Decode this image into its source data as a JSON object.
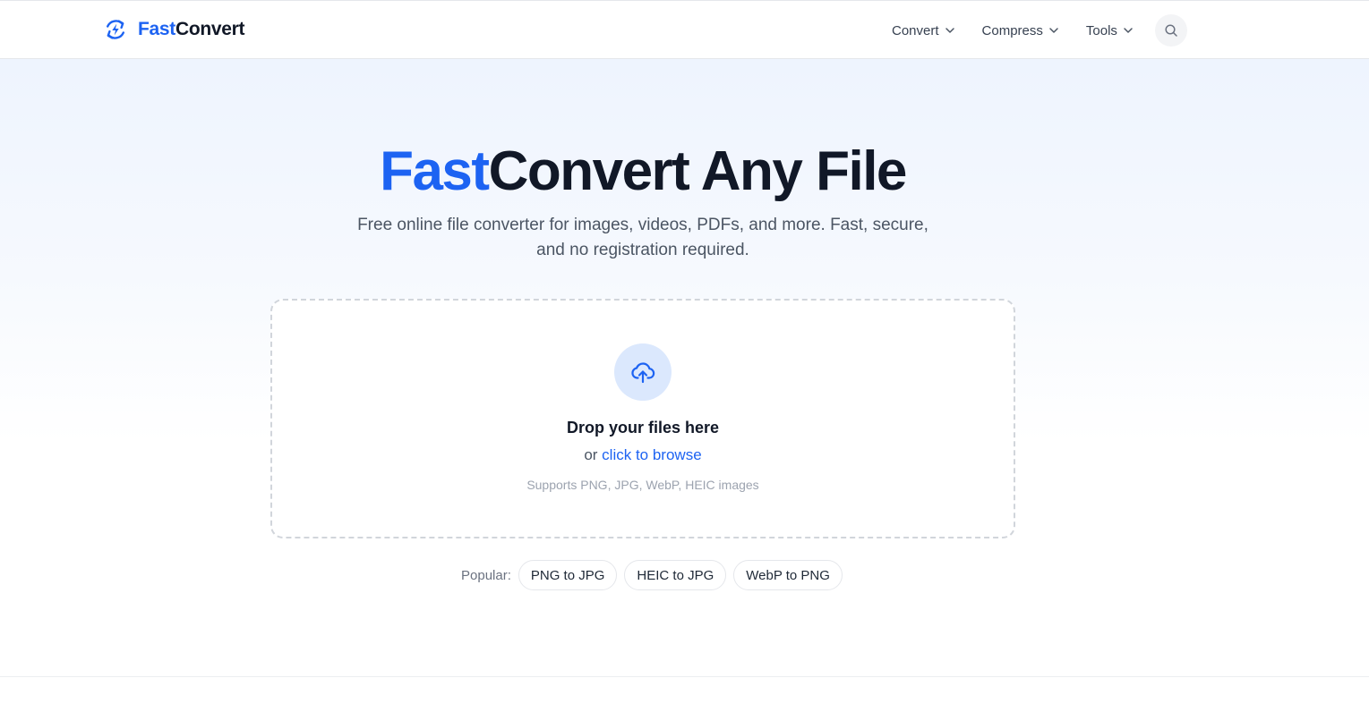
{
  "header": {
    "logo_part1": "Fast",
    "logo_part2": "Convert",
    "logo_icon": "lightning-refresh-icon",
    "nav": [
      {
        "label": "Convert",
        "icon": "chevron-down-icon"
      },
      {
        "label": "Compress",
        "icon": "chevron-down-icon"
      },
      {
        "label": "Tools",
        "icon": "chevron-down-icon"
      }
    ],
    "search_icon": "search-icon"
  },
  "hero": {
    "title_part1": "Fast",
    "title_part2": "Convert Any File",
    "subtitle": "Free online file converter for images, videos, PDFs, and more. Fast, secure, and no registration required."
  },
  "dropzone": {
    "icon": "upload-cloud-icon",
    "title": "Drop your files here",
    "browse_prefix": "or ",
    "browse_link": "click to browse",
    "hint": "Supports PNG, JPG, WebP, HEIC images"
  },
  "popular": {
    "label": "Popular:",
    "items": [
      "PNG to JPG",
      "HEIC to JPG",
      "WebP to PNG"
    ]
  },
  "colors": {
    "brand": "#1d63f2",
    "text_dark": "#111827",
    "text_muted": "#4b5563",
    "upload_circle_bg": "#dbe8fd"
  }
}
